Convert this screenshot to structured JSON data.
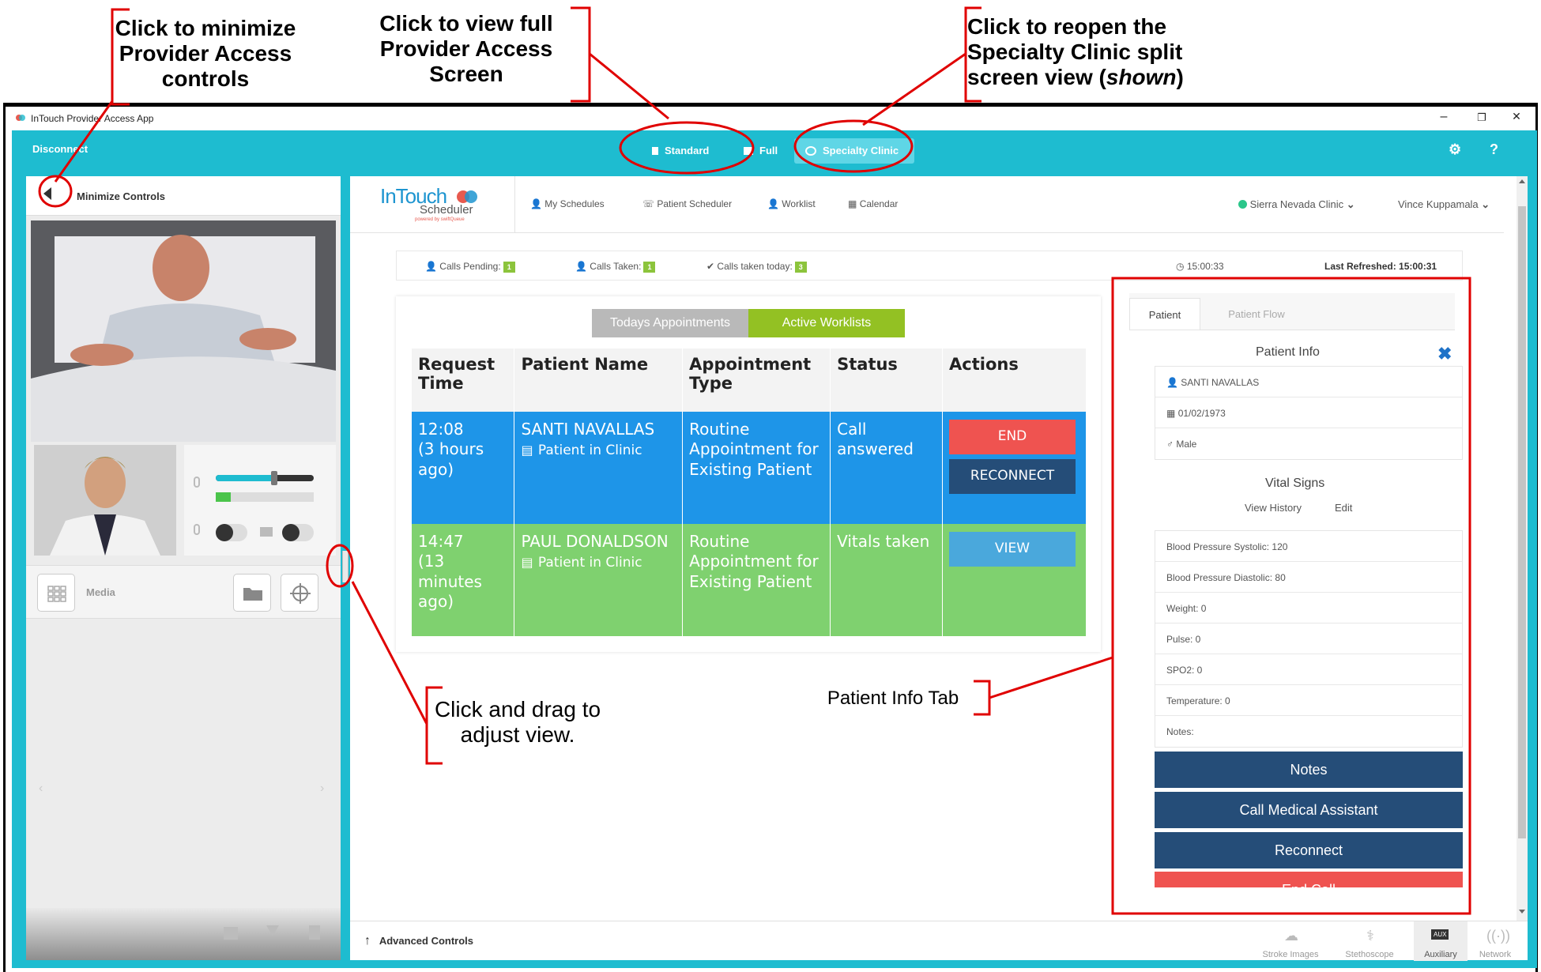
{
  "annotations": {
    "minimize_line1": "Click to minimize",
    "minimize_line2": "Provider Access",
    "minimize_line3": "controls",
    "full_line1": "Click to view full",
    "full_line2": "Provider Access",
    "full_line3": "Screen",
    "specialty_line1": "Click to reopen the",
    "specialty_line2": "Specialty Clinic split",
    "specialty_line3a": "screen view (",
    "specialty_line3b": "shown",
    "specialty_line3c": ")",
    "drag_line1": "Click and drag to",
    "drag_line2": "adjust view.",
    "patient_info_tab": "Patient Info Tab"
  },
  "window": {
    "title": "InTouch Provider Access App",
    "minimize": "–",
    "restore": "❐",
    "close": "✕"
  },
  "topbar": {
    "disconnect": "Disconnect",
    "standard": "Standard",
    "full": "Full",
    "specialty": "Specialty Clinic",
    "gear_icon": "⚙",
    "help_icon": "?"
  },
  "left_panel": {
    "minimize_controls": "Minimize Controls",
    "media": "Media",
    "mic_slider_level": 0.6,
    "audio_meter_level": 0.15
  },
  "scheduler": {
    "logo_main": "InTouch",
    "logo_sub": "Scheduler",
    "logo_tag": "powered by swiftQueue",
    "nav": {
      "my_schedules": "My Schedules",
      "patient_scheduler": "Patient Scheduler",
      "worklist": "Worklist",
      "calendar": "Calendar",
      "clinic": "Sierra Nevada Clinic",
      "user": "Vince Kuppamala"
    },
    "status": {
      "calls_pending_label": "Calls Pending:",
      "calls_pending": "1",
      "calls_taken_label": "Calls Taken:",
      "calls_taken": "1",
      "calls_today_label": "Calls taken today:",
      "calls_today": "3",
      "clock": "15:00:33",
      "last_refreshed": "Last Refreshed: 15:00:31"
    },
    "tabs": {
      "todays": "Todays Appointments",
      "active": "Active Worklists"
    },
    "table": {
      "headers": [
        "Request Time",
        "Patient Name",
        "Appointment Type",
        "Status",
        "Actions"
      ],
      "rows": [
        {
          "time": "12:08",
          "ago": "(3 hours ago)",
          "name": "SANTI NAVALLAS",
          "location": "Patient in Clinic",
          "type": "Routine Appointment for Existing Patient",
          "status": "Call answered",
          "btn1": "END",
          "btn2": "RECONNECT"
        },
        {
          "time": "14:47",
          "ago": "(13 minutes ago)",
          "name": "PAUL DONALDSON",
          "location": "Patient in Clinic",
          "type": "Routine Appointment for Existing Patient",
          "status": "Vitals taken",
          "btn1": "VIEW"
        }
      ]
    }
  },
  "patient_panel": {
    "tab_patient": "Patient",
    "tab_flow": "Patient Flow",
    "info_title": "Patient Info",
    "name": "SANTI NAVALLAS",
    "dob": "01/02/1973",
    "sex": "Male",
    "vitals_title": "Vital Signs",
    "view_history": "View History",
    "edit": "Edit",
    "vitals": [
      "Blood Pressure Systolic: 120",
      "Blood Pressure Diastolic: 80",
      "Weight: 0",
      "Pulse: 0",
      "SPO2: 0",
      "Temperature: 0",
      "Notes:"
    ],
    "btn_notes": "Notes",
    "btn_call_ma": "Call Medical Assistant",
    "btn_reconnect": "Reconnect",
    "btn_end_call": "End Call"
  },
  "advanced": {
    "label": "Advanced Controls",
    "stroke": "Stroke Images",
    "stethoscope": "Stethoscope",
    "auxiliary": "Auxiliary",
    "aux_badge": "AUX",
    "network": "Network"
  },
  "colors": {
    "teal": "#1ebcd0",
    "navy": "#254d78",
    "blue_row": "#1e95e8",
    "green_row": "#7fd16f",
    "red": "#ef5350",
    "annotation_red": "#e00000"
  }
}
